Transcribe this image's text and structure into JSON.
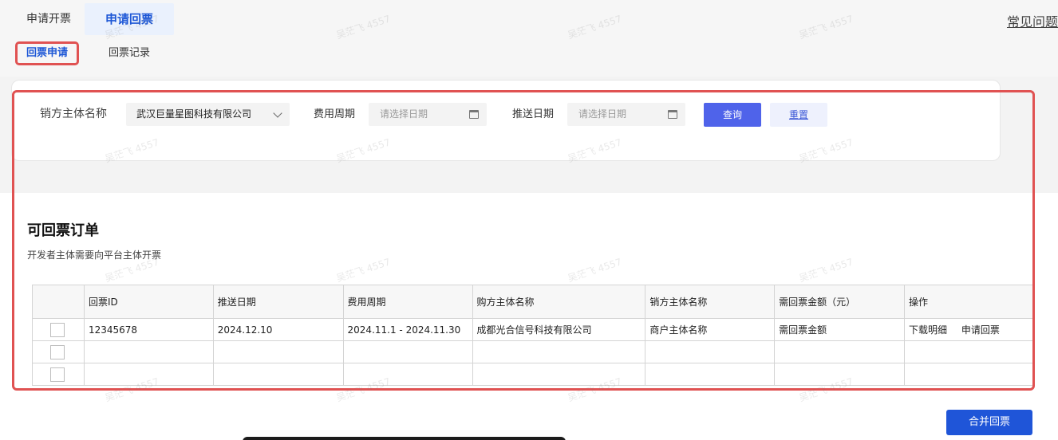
{
  "top_tabs": {
    "invoice_apply": "申请开票",
    "return_apply": "申请回票"
  },
  "faq": "常见问题",
  "sub_tabs": {
    "apply": "回票申请",
    "records": "回票记录"
  },
  "filters": {
    "seller_label": "销方主体名称",
    "seller_value": "武汉巨量星图科技有限公司",
    "period_label": "费用周期",
    "period_placeholder": "请选择日期",
    "push_label": "推送日期",
    "push_placeholder": "请选择日期",
    "query_button": "查询",
    "reset_button": "重置"
  },
  "section": {
    "title": "可回票订单",
    "subtitle": "开发者主体需要向平台主体开票"
  },
  "table": {
    "headers": [
      "回票ID",
      "推送日期",
      "费用周期",
      "购方主体名称",
      "销方主体名称",
      "需回票金额（元）",
      "操作"
    ],
    "rows": [
      {
        "id": "12345678",
        "push_date": "2024.12.10",
        "period": "2024.11.1 - 2024.11.30",
        "buyer": "成都光合信号科技有限公司",
        "seller": "商户主体名称",
        "amount": "需回票金额",
        "ops": [
          "下载明细",
          "申请回票"
        ]
      }
    ]
  },
  "merge_button": "合并回票",
  "watermark": "吴茫飞 4557"
}
